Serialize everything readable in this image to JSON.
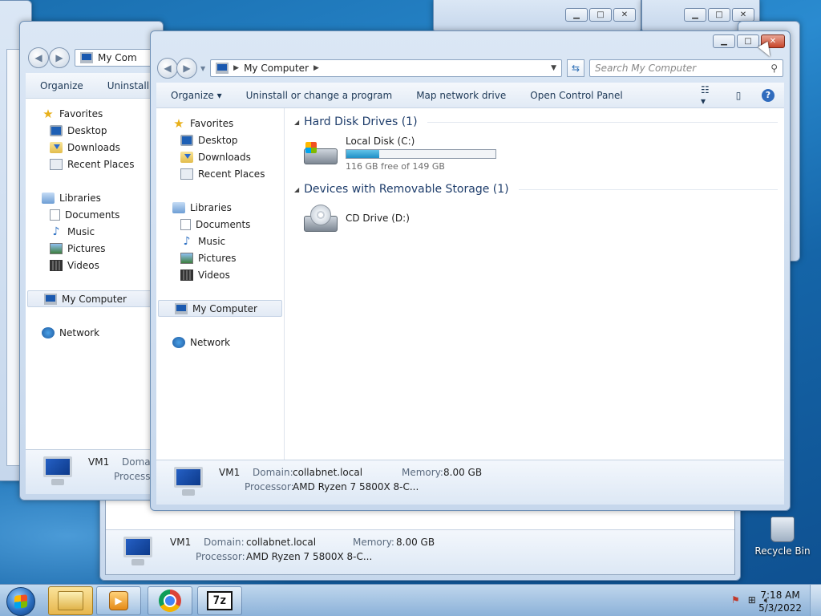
{
  "main_window": {
    "address_label": "My Computer",
    "search_placeholder": "Search My Computer",
    "toolbar": {
      "organize": "Organize",
      "uninstall": "Uninstall or change a program",
      "map_drive": "Map network drive",
      "control_panel": "Open Control Panel"
    },
    "nav": {
      "favorites": "Favorites",
      "desktop": "Desktop",
      "downloads": "Downloads",
      "recent_places": "Recent Places",
      "libraries": "Libraries",
      "documents": "Documents",
      "music": "Music",
      "pictures": "Pictures",
      "videos": "Videos",
      "my_computer": "My Computer",
      "network": "Network"
    },
    "groups": {
      "hdd_title": "Hard Disk Drives (1)",
      "removable_title": "Devices with Removable Storage (1)"
    },
    "drives": {
      "c_name": "Local Disk (C:)",
      "c_free": "116 GB free of 149 GB",
      "c_used_fraction": 0.22,
      "d_name": "CD Drive (D:)"
    },
    "details": {
      "computer_name": "VM1",
      "domain_label": "Domain:",
      "domain_value": "collabnet.local",
      "memory_label": "Memory:",
      "memory_value": "8.00 GB",
      "processor_label": "Processor:",
      "processor_value": "AMD Ryzen 7 5800X 8-C..."
    }
  },
  "back_window_left": {
    "address_label": "My Com",
    "organize": "Organize",
    "uninstall": "Uninstall",
    "computer_name": "VM1",
    "domain_label": "Domai",
    "processor_label": "Processo"
  },
  "back_window_bottom": {
    "computer_name": "VM1",
    "domain_label": "Domain:",
    "domain_value": "collabnet.local",
    "memory_label": "Memory:",
    "memory_value": "8.00 GB",
    "processor_label": "Processor:",
    "processor_value": "AMD Ryzen 7 5800X 8-C..."
  },
  "desktop": {
    "recycle_bin": "Recycle Bin"
  },
  "taskbar": {
    "time": "7:18 AM",
    "date": "5/3/2022",
    "seven_zip_label": "7z"
  }
}
